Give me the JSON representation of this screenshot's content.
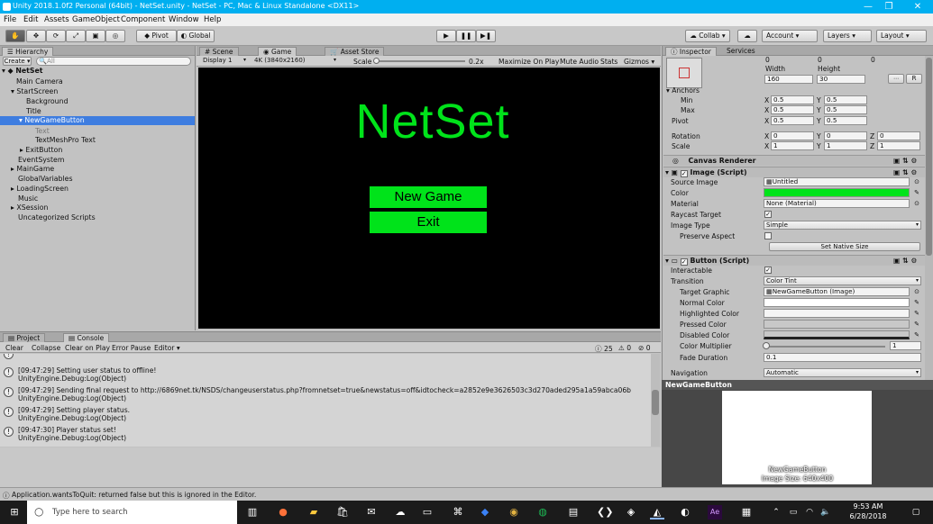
{
  "window": {
    "title": "Unity 2018.1.0f2 Personal (64bit) - NetSet.unity - NetSet - PC, Mac & Linux Standalone <DX11>"
  },
  "menu": [
    "File",
    "Edit",
    "Assets",
    "GameObject",
    "Component",
    "Window",
    "Help"
  ],
  "toolbar": {
    "pivot": "Pivot",
    "global": "Global",
    "collab": "Collab",
    "account": "Account",
    "layers": "Layers",
    "layout": "Layout"
  },
  "hierarchy": {
    "tab": "Hierarchy",
    "create": "Create",
    "search_placeholder": "All",
    "scene": "NetSet",
    "items": [
      {
        "label": "Main Camera"
      },
      {
        "label": "StartScreen"
      },
      {
        "label": "Background"
      },
      {
        "label": "Title"
      },
      {
        "label": "NewGameButton"
      },
      {
        "label": "Text"
      },
      {
        "label": "TextMeshPro Text"
      },
      {
        "label": "ExitButton"
      },
      {
        "label": "EventSystem"
      },
      {
        "label": "MainGame"
      },
      {
        "label": "GlobalVariables"
      },
      {
        "label": "LoadingScreen"
      },
      {
        "label": "Music"
      },
      {
        "label": "XSession"
      },
      {
        "label": "Uncategorized Scripts"
      }
    ]
  },
  "view_tabs": {
    "scene": "Scene",
    "game": "Game",
    "asset_store": "Asset Store"
  },
  "game_toolbar": {
    "display": "Display 1",
    "resolution": "4K (3840x2160)",
    "scale_label": "Scale",
    "scale_value": "0.2x",
    "maximize": "Maximize On Play",
    "mute": "Mute Audio",
    "stats": "Stats",
    "gizmos": "Gizmos"
  },
  "game": {
    "title": "NetSet",
    "new_game": "New Game",
    "exit": "Exit"
  },
  "bottom_tabs": {
    "project": "Project",
    "console": "Console"
  },
  "console": {
    "clear": "Clear",
    "collapse": "Collapse",
    "clear_on_play": "Clear on Play",
    "error_pause": "Error Pause",
    "editor": "Editor",
    "count_info": "25",
    "count_warn": "0",
    "count_error": "0",
    "entries": [
      {
        "line1": "[09:47:29] Setting user status to offline!",
        "line2": "UnityEngine.Debug:Log(Object)"
      },
      {
        "line1": "[09:47:29] Sending final request to http://6869net.tk/NSDS/changeuserstatus.php?fromnetset=true&newstatus=off&idtocheck=a2852e9e3626503c3d270aded295a1a59abca06b",
        "line2": "UnityEngine.Debug:Log(Object)"
      },
      {
        "line1": "[09:47:29] Setting player status.",
        "line2": "UnityEngine.Debug:Log(Object)"
      },
      {
        "line1": "[09:47:30] Player status set!",
        "line2": "UnityEngine.Debug:Log(Object)"
      }
    ],
    "status": "Application.wantsToQuit: returned false but this is ignored in the Editor."
  },
  "inspector": {
    "tab": "Inspector",
    "services": "Services",
    "pos": [
      "0",
      "0",
      "0"
    ],
    "width_label": "Width",
    "height_label": "Height",
    "width": "160",
    "height": "30",
    "anchors": "Anchors",
    "min": "Min",
    "max": "Max",
    "pivot": "Pivot",
    "min_x": "0.5",
    "min_y": "0.5",
    "max_x": "0.5",
    "max_y": "0.5",
    "pivot_x": "0.5",
    "pivot_y": "0.5",
    "rotation": "Rotation",
    "scale": "Scale",
    "rot": [
      "0",
      "0",
      "0"
    ],
    "scl": [
      "1",
      "1",
      "1"
    ],
    "canvas_renderer": "Canvas Renderer",
    "image_script": "Image (Script)",
    "source_image": "Source Image",
    "source_image_val": "Untitled",
    "color": "Color",
    "color_value": "#00e31a",
    "material": "Material",
    "material_val": "None (Material)",
    "raycast": "Raycast Target",
    "image_type": "Image Type",
    "image_type_val": "Simple",
    "preserve": "Preserve Aspect",
    "set_native": "Set Native Size",
    "button_script": "Button (Script)",
    "interactable": "Interactable",
    "transition": "Transition",
    "transition_val": "Color Tint",
    "target_graphic": "Target Graphic",
    "target_graphic_val": "NewGameButton (Image)",
    "normal_color": "Normal Color",
    "highlighted_color": "Highlighted Color",
    "pressed_color": "Pressed Color",
    "disabled_color": "Disabled Color",
    "color_multiplier": "Color Multiplier",
    "color_multiplier_val": "1",
    "fade_duration": "Fade Duration",
    "fade_duration_val": "0.1",
    "navigation": "Navigation",
    "navigation_val": "Automatic",
    "x": "X",
    "y": "Y",
    "z": "Z",
    "r": "R"
  },
  "preview": {
    "header": "NewGameButton",
    "name": "NewGameButton",
    "size": "Image Size: 640x400"
  },
  "taskbar": {
    "search_placeholder": "Type here to search",
    "time": "9:53 AM",
    "date": "6/28/2018"
  }
}
